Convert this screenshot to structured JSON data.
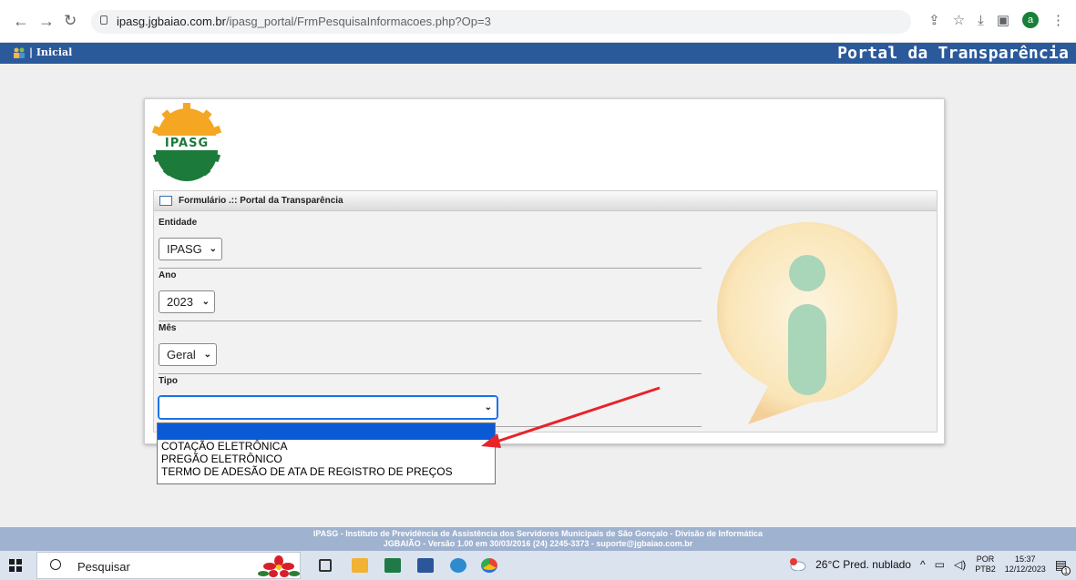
{
  "browser": {
    "url_host": "ipasg.jgbaiao.com.br",
    "url_path": "/ipasg_portal/FrmPesquisaInformacoes.php?Op=3",
    "profile_initial": "a"
  },
  "header": {
    "home_label": "| Inicial",
    "portal_title": "Portal da Transparência"
  },
  "form": {
    "title": "Formulário .:: Portal da Transparência",
    "entidade_label": "Entidade",
    "entidade_value": "IPASG",
    "ano_label": "Ano",
    "ano_value": "2023",
    "mes_label": "Mês",
    "mes_value": "Geral",
    "tipo_label": "Tipo",
    "tipo_value": ""
  },
  "tipo_options": [
    "",
    "COTAÇÃO ELETRÔNICA",
    "PREGÃO ELETRÔNICO",
    "TERMO DE ADESÃO DE ATA DE REGISTRO DE PREÇOS"
  ],
  "footer": {
    "line1": "IPASG - Instituto de Previdência de Assistência dos Servidores Municipais de São Gonçalo - Divisão de Informática",
    "line2": "JGBAIÃO - Versão 1.00 em 30/03/2016  (24) 2245-3373 - suporte@jgbaiao.com.br"
  },
  "taskbar": {
    "search_placeholder": "Pesquisar",
    "weather": "26°C  Pred. nublado",
    "lang": "POR",
    "layout": "PTB2",
    "time": "15:37",
    "date": "12/12/2023",
    "notification_count": "1"
  },
  "colors": {
    "header_blue": "#2b5a9b",
    "footer_blue": "#9fb2cf",
    "dropdown_selected": "#0a5ad6",
    "annotation_arrow": "#e8232a"
  }
}
